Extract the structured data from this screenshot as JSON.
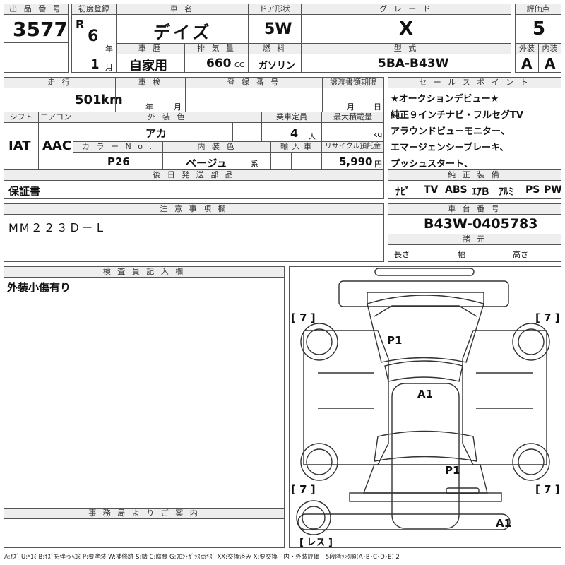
{
  "labels": {
    "lot_no": "出 品 番 号",
    "first_reg": "初度登録",
    "car_name": "車 名",
    "door": "ドア形状",
    "grade": "グ レ ー ド",
    "score": "評価点",
    "history": "車 歴",
    "displacement": "排 気 量",
    "fuel": "燃 料",
    "model_type": "型 式",
    "exterior": "外装",
    "interior": "内装",
    "mileage": "走 行",
    "inspection": "車 検",
    "reg_no": "登 録 番 号",
    "transfer": "譲渡書類期限",
    "sales_point": "セ ー ル ス ポ イ ン ト",
    "shift": "シフト",
    "aircon": "エアコン",
    "ext_color": "外 装 色",
    "capacity": "乗車定員",
    "max_load": "最大積載量",
    "color_no": "カ ラ ー N o .",
    "int_color": "内 装 色",
    "import": "輸 入 車",
    "recycle": "リサイクル預託金",
    "later_parts": "後 日 発 送 部 品",
    "equipment": "純 正 装 備",
    "notes": "注 意 事 項 欄",
    "chassis_no": "車 台 番 号",
    "specs": "諸 元",
    "inspector": "検 査 員 記 入 欄",
    "office": "事 務 局 よ り ご 案 内"
  },
  "units": {
    "reiwa": "R",
    "year": "年",
    "month": "月",
    "cc": "CC",
    "km": "km",
    "persons": "人",
    "kg": "kg",
    "yen": "円",
    "kei": "系"
  },
  "vehicle": {
    "lot_no": "3577",
    "reg_year": "6",
    "reg_month": "1",
    "name": "デイズ",
    "door": "5W",
    "grade": "X",
    "score": "5",
    "history": "自家用",
    "displacement": "660",
    "fuel": "ガソリン",
    "model_type": "5BA-B43W",
    "exterior_score": "A",
    "interior_score": "A",
    "mileage": "501",
    "shift": "IAT",
    "aircon": "AAC",
    "ext_color": "アカ",
    "capacity": "4",
    "color_no": "P26",
    "int_color": "ベージュ",
    "recycle": "5,990",
    "later_parts": "保証書",
    "notes": "MM２２３Ｄ－Ｌ",
    "chassis_no": "B43W-0405783",
    "inspector_comment": "外装小傷有り"
  },
  "sales_points": [
    "★オークションデビュー★",
    "純正９インチナビ・フルセグTV",
    "アラウンドビューモニター、",
    "エマージェンシーブレーキ、",
    "プッシュスタート、"
  ],
  "equipment": [
    "ﾅﾋﾞ",
    "TV",
    "ABS",
    "ｴｱB",
    "ｱﾙﾐ",
    "PS",
    "PW"
  ],
  "specs": {
    "length": "長さ",
    "width": "幅",
    "height": "高さ"
  },
  "diagram": {
    "tire_fl": "[ 7 ]",
    "tire_fr": "[ 7 ]",
    "tire_rl": "[ 7 ]",
    "tire_rr": "[ 7 ]",
    "spare": "[ レス ]",
    "mark_hood": "P1",
    "mark_roof": "A1",
    "mark_trunk": "P1",
    "mark_bumper": "A1"
  },
  "legend": "A:ｷｽﾞ U:ﾍｺﾐ B:ｷｽﾞを伴うﾍｺﾐ P:要塗装 W:補修跡 S:錆 C:腐食 G:ﾌﾛﾝﾄｶﾞﾗｽ点ｷｽﾞ XX:交換済み X:要交換　内・外装評価　5段階ﾗﾝｸ順(A･B･C･D･E) 2"
}
